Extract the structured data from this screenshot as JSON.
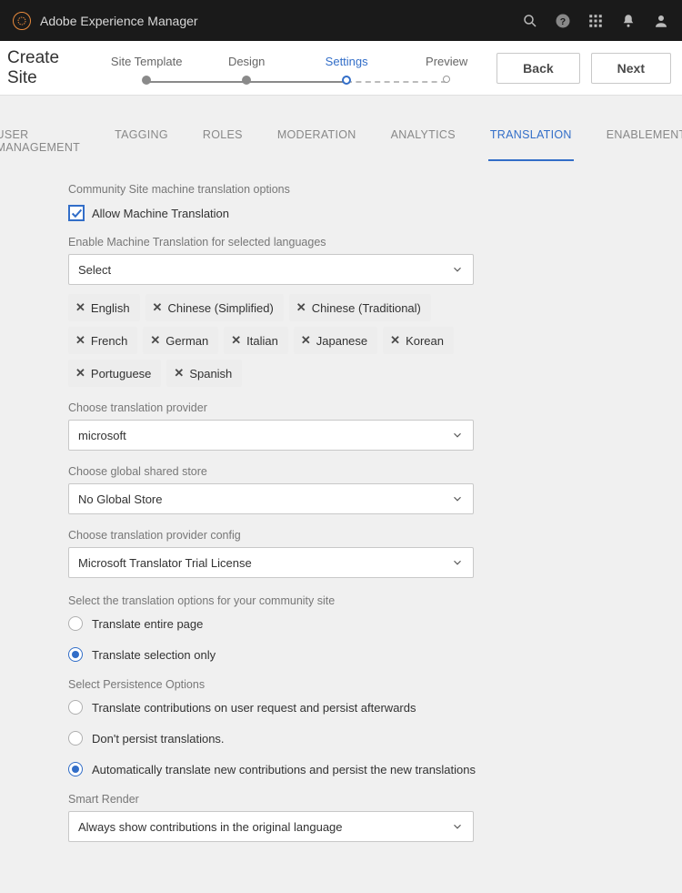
{
  "header": {
    "app_title": "Adobe Experience Manager"
  },
  "subheader": {
    "page_title": "Create Site",
    "steps": [
      "Site Template",
      "Design",
      "Settings",
      "Preview"
    ],
    "buttons": {
      "back": "Back",
      "next": "Next"
    }
  },
  "tabs": [
    "USER MANAGEMENT",
    "TAGGING",
    "ROLES",
    "MODERATION",
    "ANALYTICS",
    "TRANSLATION",
    "ENABLEMENT"
  ],
  "form": {
    "section_heading": "Community Site machine translation options",
    "allow_label": "Allow Machine Translation",
    "enable_langs_label": "Enable Machine Translation for selected languages",
    "enable_langs_value": "Select",
    "langs": [
      "English",
      "Chinese (Simplified)",
      "Chinese (Traditional)",
      "French",
      "German",
      "Italian",
      "Japanese",
      "Korean",
      "Portuguese",
      "Spanish"
    ],
    "provider_label": "Choose translation provider",
    "provider_value": "microsoft",
    "globalstore_label": "Choose global shared store",
    "globalstore_value": "No Global Store",
    "providerconfig_label": "Choose translation provider config",
    "providerconfig_value": "Microsoft Translator Trial License",
    "options_heading": "Select the translation options for your community site",
    "opt1": "Translate entire page",
    "opt2": "Translate selection only",
    "persist_heading": "Select Persistence Options",
    "p1": "Translate contributions on user request and persist afterwards",
    "p2": "Don't persist translations.",
    "p3": "Automatically translate new contributions and persist the new translations",
    "smart_label": "Smart Render",
    "smart_value": "Always show contributions in the original language"
  }
}
